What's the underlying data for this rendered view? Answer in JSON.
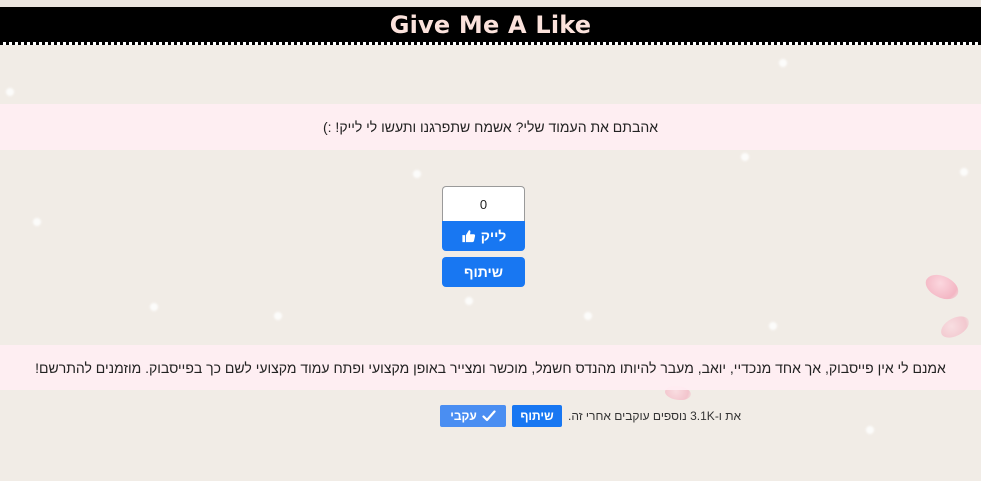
{
  "header": {
    "title": "Give Me A Like"
  },
  "intro": {
    "text": "אהבתם את העמוד שלי? אשמח שתפרגנו ותעשו לי לייק! :)"
  },
  "like_widget": {
    "count": "0",
    "like_label": "לייק",
    "like_icon": "thumbs-up-icon",
    "share_label": "שיתוף"
  },
  "about": {
    "text": "אמנם לי אין פייסבוק, אך אחד מנכדיי, יואב, מעבר להיותו מהנדס חשמל, מוכשר ומצייר באופן מקצועי ופתח עמוד מקצועי לשם כך בפייסבוק. מוזמנים להתרשם!"
  },
  "follow_bar": {
    "follow_label": "עקבי",
    "follow_icon": "checkmark-icon",
    "share_label": "שיתוף",
    "followers_text": "את ו-3.1K נוספים עוקבים אחרי זה."
  },
  "colors": {
    "header_bg": "#000000",
    "title_color": "#fbe2dc",
    "facebook_blue": "#1877f2",
    "follow_blue": "#4a8ef2",
    "band_bg": "#ffeef3",
    "page_bg": "#f1ece6"
  }
}
